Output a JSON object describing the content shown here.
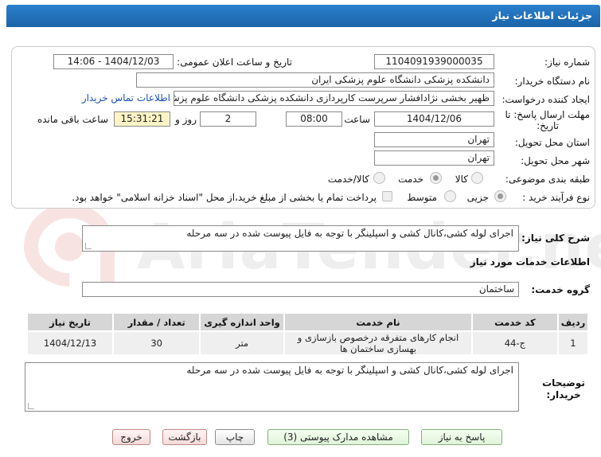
{
  "header": {
    "title": "جزئیات اطلاعات نیاز"
  },
  "watermark": {
    "text": "AriaTender.net"
  },
  "form": {
    "need_number_label": "شماره نیاز:",
    "need_number": "1104091939000035",
    "announce_label": "تاریخ و ساعت اعلان عمومی:",
    "announce_value": "1404/12/03 - 14:06",
    "buyer_org_label": "نام دستگاه خریدار:",
    "buyer_org": "دانشکده پزشکی دانشگاه علوم پزشکی ایران",
    "requester_label": "ایجاد کننده درخواست:",
    "requester": "ظهیر بخشی نژادافشار سرپرست کارپردازی دانشکده پزشکی دانشگاه علوم پزش",
    "contact_link": "اطلاعات تماس خریدار",
    "deadline_label_1": "مهلت ارسال پاسخ: تا",
    "deadline_label_2": "تاریخ:",
    "deadline_date": "1404/12/06",
    "time_label": "ساعت",
    "deadline_time": "08:00",
    "days_value": "2",
    "days_label": "روز و",
    "remaining_time": "15:31:21",
    "remaining_label": "ساعت باقی مانده",
    "province_label": "استان محل تحویل:",
    "province": "تهران",
    "city_label": "شهر محل تحویل:",
    "city": "تهران",
    "category_label": "طبقه بندی موضوعی:",
    "category_options": [
      "کالا",
      "خدمت",
      "کالا/خدمت"
    ],
    "process_label": "نوع فرآیند خرید :",
    "process_options": [
      "جزیی",
      "متوسط"
    ],
    "payment_note": "پرداخت تمام یا بخشی از مبلغ خرید،از محل \"اسناد خزانه اسلامی\" خواهد بود."
  },
  "summary": {
    "label": "شرح کلی نیاز:",
    "text": "اجرای لوله کشی،کانال کشی و اسپلینگر با توجه به فایل پیوست شده در سه مرحله"
  },
  "services": {
    "section_title": "اطلاعات خدمات مورد نیاز",
    "group_label": "گروه خدمت:",
    "group_value": "ساختمان",
    "columns": [
      "ردیف",
      "کد خدمت",
      "نام خدمت",
      "واحد اندازه گیری",
      "تعداد / مقدار",
      "تاریخ نیاز"
    ],
    "rows": [
      [
        "1",
        "ج-44",
        "انجام کارهای متفرقه درخصوص بازسازی و بهسازی ساختمان ها",
        "متر",
        "30",
        "1404/12/13"
      ]
    ]
  },
  "notes": {
    "label_1": "توضیحات",
    "label_2": "خریدار:",
    "text": "اجرای لوله کشی،کانال کشی و اسپلینگر با توجه به فایل پیوست شده در سه مرحله"
  },
  "buttons": {
    "reply": "پاسخ به نیاز",
    "docs": "مشاهده مدارک پیوستی (3)",
    "print": "چاپ",
    "back": "بازگشت",
    "exit": "خروج"
  },
  "colors": {
    "title_bar": "#1a64a8",
    "highlight_box": "#fff4c6",
    "link": "#1a4fb5"
  }
}
